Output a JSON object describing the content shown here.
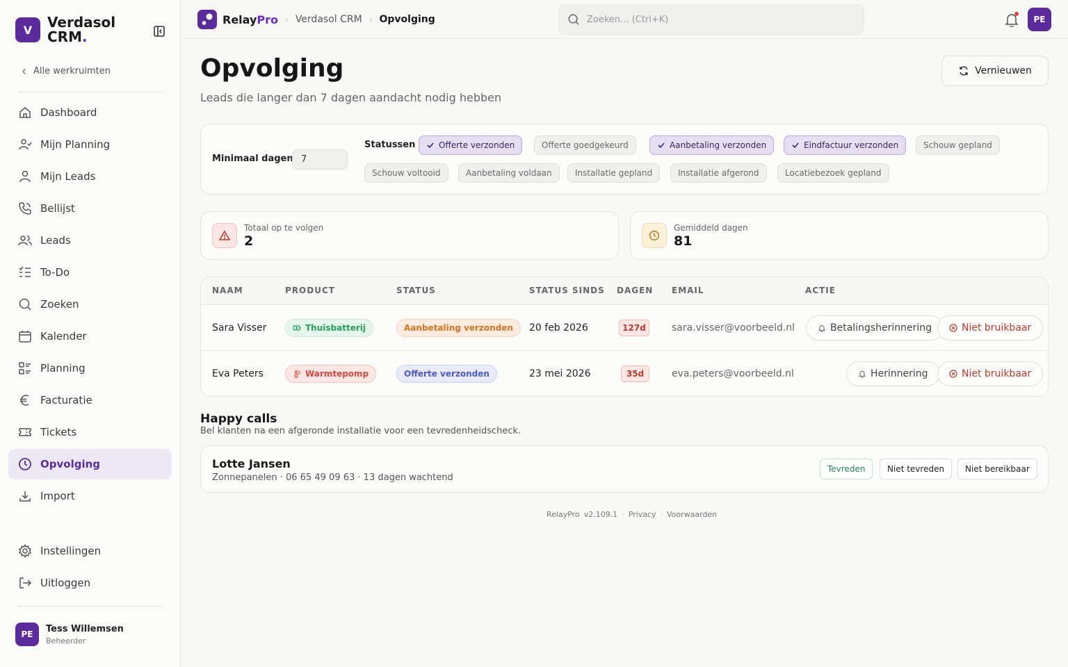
{
  "brand": {
    "logo_letter": "V",
    "name_line1": "Verdasol",
    "name_line2": "CRM",
    "name_dot": "."
  },
  "sidebar": {
    "back_label": "Alle werkruimten",
    "items": [
      {
        "label": "Dashboard",
        "icon": "home-icon"
      },
      {
        "label": "Mijn Planning",
        "icon": "person-route-icon"
      },
      {
        "label": "Mijn Leads",
        "icon": "user-icon"
      },
      {
        "label": "Bellijst",
        "icon": "phone-icon"
      },
      {
        "label": "Leads",
        "icon": "users-icon"
      },
      {
        "label": "To-Do",
        "icon": "checklist-icon"
      },
      {
        "label": "Zoeken",
        "icon": "search-icon"
      },
      {
        "label": "Kalender",
        "icon": "calendar-icon"
      },
      {
        "label": "Planning",
        "icon": "planning-icon"
      },
      {
        "label": "Facturatie",
        "icon": "euro-icon"
      },
      {
        "label": "Tickets",
        "icon": "ticket-icon"
      },
      {
        "label": "Opvolging",
        "icon": "clock-icon",
        "active": true
      },
      {
        "label": "Import",
        "icon": "download-icon"
      }
    ],
    "bottom_items": [
      {
        "label": "Instellingen",
        "icon": "gear-icon"
      },
      {
        "label": "Uitloggen",
        "icon": "logout-icon"
      }
    ],
    "user": {
      "initials": "PE",
      "name": "Tess Willemsen",
      "role": "Beheerder"
    }
  },
  "topbar": {
    "app_name": "Relay",
    "app_name_accent": "Pro",
    "crumbs": [
      "Verdasol CRM",
      "Opvolging"
    ],
    "search_placeholder": "Zoeken... (Ctrl+K)",
    "avatar_initials": "PE"
  },
  "page": {
    "title": "Opvolging",
    "subtitle": "Leads die langer dan 7 dagen aandacht nodig hebben",
    "refresh_label": "Vernieuwen"
  },
  "filters": {
    "min_days_label": "Minimaal dagen",
    "min_days_value": "7",
    "statuses_label": "Statussen",
    "statuses": [
      {
        "label": "Offerte verzonden",
        "selected": true
      },
      {
        "label": "Offerte goedgekeurd",
        "selected": false
      },
      {
        "label": "Aanbetaling verzonden",
        "selected": true
      },
      {
        "label": "Eindfactuur verzonden",
        "selected": true
      },
      {
        "label": "Schouw gepland",
        "selected": false
      },
      {
        "label": "Schouw voltooid",
        "selected": false
      },
      {
        "label": "Aanbetaling voldaan",
        "selected": false
      },
      {
        "label": "Installatie gepland",
        "selected": false
      },
      {
        "label": "Installatie afgerond",
        "selected": false
      },
      {
        "label": "Locatiebezoek gepland",
        "selected": false
      }
    ]
  },
  "stats": {
    "total_label": "Totaal op te volgen",
    "total_value": "2",
    "avg_label": "Gemiddeld dagen",
    "avg_value": "81"
  },
  "table": {
    "headers": [
      "NAAM",
      "PRODUCT",
      "STATUS",
      "STATUS SINDS",
      "DAGEN",
      "EMAIL",
      "ACTIE"
    ],
    "rows": [
      {
        "name": "Sara Visser",
        "product": "Thuisbatterij",
        "status": "Aanbetaling verzonden",
        "since": "20 feb 2026",
        "days": "127d",
        "email": "sara.visser@voorbeeld.nl",
        "action1": "Betalingsherinnering",
        "action2": "Niet bruikbaar"
      },
      {
        "name": "Eva Peters",
        "product": "Warmtepomp",
        "status": "Offerte verzonden",
        "since": "23 mei 2026",
        "days": "35d",
        "email": "eva.peters@voorbeeld.nl",
        "action1": "Herinnering",
        "action2": "Niet bruikbaar"
      }
    ]
  },
  "happy_calls": {
    "title": "Happy calls",
    "subtitle": "Bel klanten na een afgeronde installatie voor een tevredenheidscheck.",
    "items": [
      {
        "name": "Lotte Jansen",
        "meta": "Zonnepanelen · 06 65 49 09 63 · 13 dagen wachtend",
        "btn_ok": "Tevreden",
        "btn_not_ok": "Niet tevreden",
        "btn_unreachable": "Niet bereikbaar"
      }
    ]
  },
  "footer": {
    "app": "RelayPro",
    "version": "v2.109.1",
    "privacy": "Privacy",
    "terms": "Voorwaarden"
  },
  "colors": {
    "accent": "#5b2a9c",
    "danger": "#c0392b",
    "success": "#1f8a54",
    "warning": "#d9731f"
  }
}
